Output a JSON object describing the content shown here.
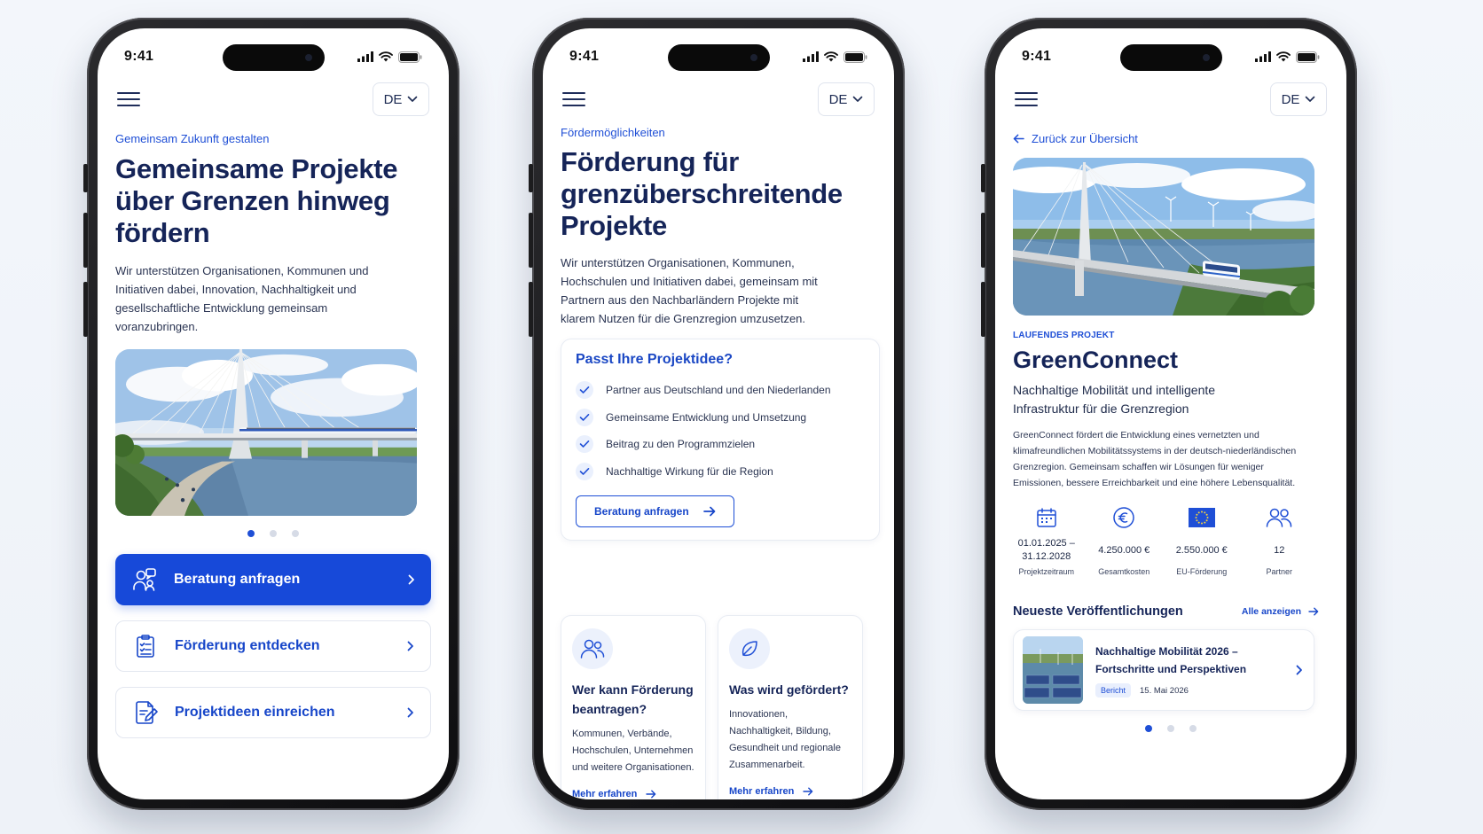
{
  "status": {
    "time": "9:41"
  },
  "lang": "DE",
  "screen1": {
    "eyebrow": "Gemeinsam Zukunft gestalten",
    "title_lines": [
      "Gemeinsame Projekte",
      "über Grenzen hinweg",
      "fördern"
    ],
    "lead": "Wir unterstützen Organisationen, Kommunen und Initiativen dabei, Innovation, Nachhaltigkeit und gesellschaftliche Entwicklung gemeinsam voranzubringen.",
    "carousel": {
      "count": 3,
      "active": 1
    },
    "actions": [
      {
        "label": "Beratung anfragen",
        "icon": "consult-icon",
        "primary": true
      },
      {
        "label": "Förderung entdecken",
        "icon": "clipboard-icon",
        "primary": false
      },
      {
        "label": "Projektideen einreichen",
        "icon": "document-edit-icon",
        "primary": false
      }
    ]
  },
  "screen2": {
    "eyebrow": "Fördermöglichkeiten",
    "title_lines": [
      "Förderung für",
      "grenzüberschreitende",
      "Projekte"
    ],
    "lead": "Wir unterstützen Organisationen, Kommunen, Hochschulen und Initiativen dabei, gemeinsam mit Partnern aus den Nachbarländern Projekte mit klarem Nutzen für die Grenzregion umzusetzen.",
    "check": {
      "title": "Passt Ihre Projektidee?",
      "items": [
        "Partner aus Deutschland und den Niederlanden",
        "Gemeinsame Entwicklung und Umsetzung",
        "Beitrag zu den Programmzielen",
        "Nachhaltige Wirkung für die Region"
      ],
      "button": "Beratung anfragen"
    },
    "cards": [
      {
        "title": "Wer kann Förderung beantragen?",
        "text": "Kommunen, Verbände, Hochschulen, Unternehmen und weitere Organisationen.",
        "link": "Mehr erfahren",
        "icon": "people-icon"
      },
      {
        "title": "Was wird gefördert?",
        "text": "Innovationen, Nachhaltigkeit, Bildung, Gesundheit und regionale Zusammenarbeit.",
        "link": "Mehr erfahren",
        "icon": "leaf-icon"
      }
    ]
  },
  "screen3": {
    "back": "Zurück zur Übersicht",
    "tag": "LAUFENDES PROJEKT",
    "title": "GreenConnect",
    "subtitle": "Nachhaltige Mobilität und intelligente Infrastruktur für die Grenzregion",
    "description": "GreenConnect fördert die Entwicklung eines vernetzten und klimafreundlichen Mobilitätssystems in der deutsch-niederländischen Grenzregion. Gemeinsam schaffen wir Lösungen für weniger Emissionen, bessere Erreichbarkeit und eine höhere Lebensqualität.",
    "stats": [
      {
        "value": "01.01.2025 – 31.12.2028",
        "label": "Projektzeitraum",
        "icon": "calendar-icon"
      },
      {
        "value": "4.250.000 €",
        "label": "Gesamtkosten",
        "icon": "euro-icon"
      },
      {
        "value": "2.550.000 €",
        "label": "EU-Förderung",
        "icon": "eu-flag-icon"
      },
      {
        "value": "12",
        "label": "Partner",
        "icon": "partners-icon"
      }
    ],
    "publications": {
      "heading": "Neueste Veröffentlichungen",
      "all_link": "Alle anzeigen",
      "item": {
        "title": "Nachhaltige Mobilität 2026 – Fortschritte und Perspektiven",
        "badge": "Bericht",
        "date": "15. Mai 2026"
      }
    },
    "carousel": {
      "count": 3,
      "active": 1
    }
  },
  "colors": {
    "accent": "#1749d9",
    "heading": "#152458",
    "text": "#2a3452"
  }
}
